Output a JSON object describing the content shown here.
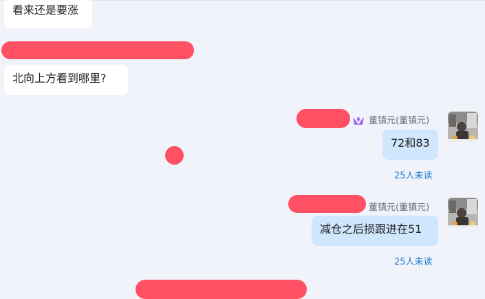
{
  "messages": [
    {
      "direction": "in",
      "text": "看来还是要涨"
    },
    {
      "direction": "in",
      "text": "北向上方看到哪里?"
    },
    {
      "direction": "out",
      "sender": "董镇元(董镇元)",
      "text": "72和83",
      "status": "25人未读"
    },
    {
      "direction": "out",
      "sender": "董镇元(董镇元)",
      "text": "减仓之后损跟进在51",
      "status": "25人未读"
    }
  ],
  "icons": {
    "vip_badge": "crown-v-icon",
    "avatar": "user-avatar-photo"
  },
  "colors": {
    "background": "#f1f3fa",
    "incoming_bubble": "#ffffff",
    "outgoing_bubble": "#cfe6fd",
    "redaction": "#ff5064",
    "unread_link": "#1a7ed6",
    "sender_name": "#6b6f78",
    "vip_badge": "#9b6cf2"
  }
}
